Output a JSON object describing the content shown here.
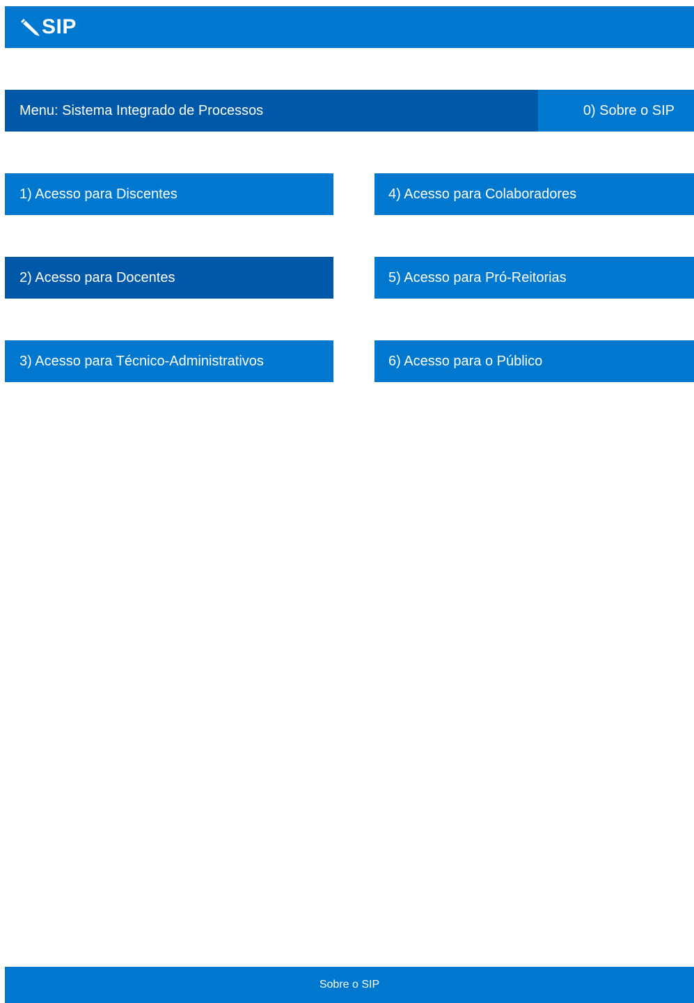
{
  "header": {
    "logo_text": "SIP",
    "logo_icon": "pencil-icon",
    "background": "#0078d0"
  },
  "menu": {
    "title": "Menu: Sistema Integrado de Processos",
    "about_label": "0) Sobre o SIP",
    "title_background": "#0058a9",
    "about_background": "#0078d0"
  },
  "tiles": [
    {
      "label": "1) Acesso para Discentes"
    },
    {
      "label": "2) Acesso para Docentes",
      "active": true
    },
    {
      "label": "3) Acesso para Técnico-Administrativos"
    },
    {
      "label": "4) Acesso para Colaboradores"
    },
    {
      "label": "5) Acesso para Pró-Reitorias"
    },
    {
      "label": "6) Acesso para o Público"
    }
  ],
  "footer": {
    "link_label": "Sobre o SIP"
  },
  "colors": {
    "primary": "#0078d0",
    "active": "#0058a9",
    "text": "#ffffff"
  }
}
